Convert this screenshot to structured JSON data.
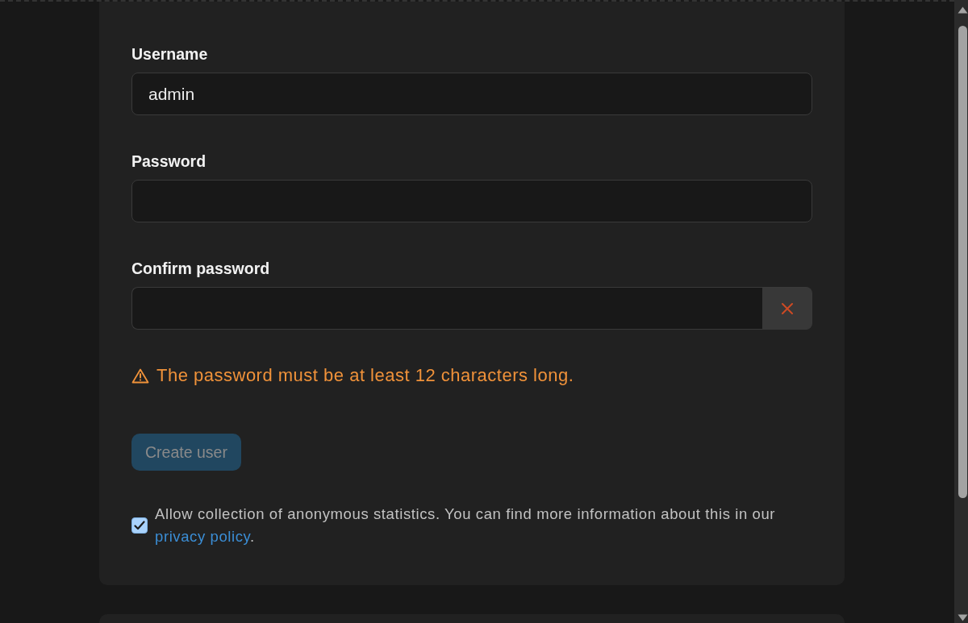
{
  "form": {
    "fields": [
      {
        "label": "Username",
        "value": "admin",
        "clear_button": false
      },
      {
        "label": "Password",
        "clear_button": false
      },
      {
        "label": "Confirm password",
        "clear_button": true
      }
    ],
    "warning": {
      "text": "The password must be at least 12 characters long."
    },
    "submit": {
      "label": "Create user",
      "disabled": true
    },
    "consent": {
      "checked": true,
      "text": "Allow collection of anonymous statistics. You can find more information about this in our",
      "link": "privacy policy",
      "text_after": "."
    }
  }
}
